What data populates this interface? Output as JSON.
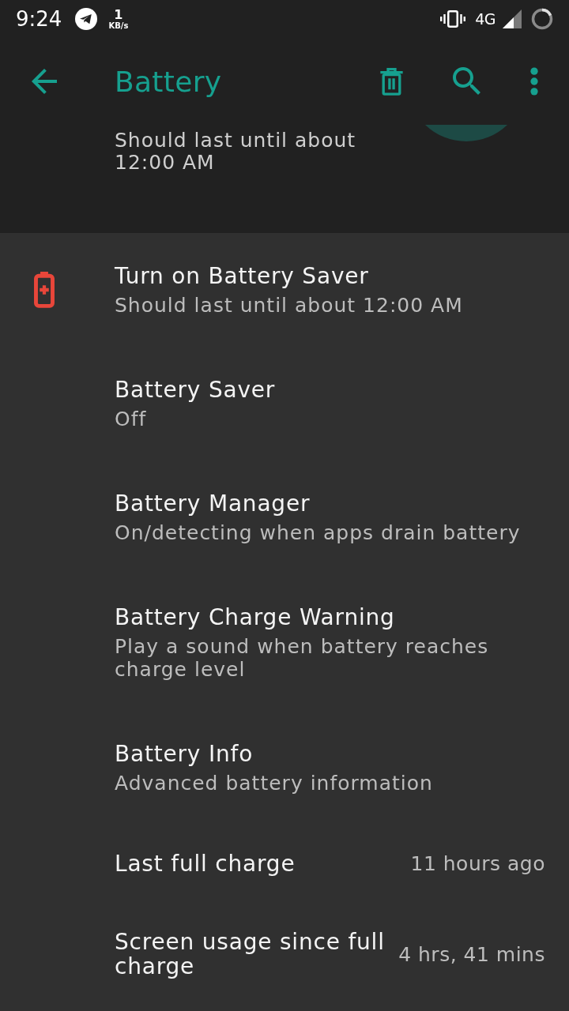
{
  "status_bar": {
    "time": "9:24",
    "net_speed": "1",
    "net_speed_unit": "KB/s",
    "network_type": "4G"
  },
  "toolbar": {
    "title": "Battery"
  },
  "estimate": {
    "text": "Should last until about 12:00 AM"
  },
  "settings": [
    {
      "kind": "warning",
      "title": "Turn on Battery Saver",
      "summary": "Should last until about 12:00 AM"
    },
    {
      "kind": "summary",
      "title": "Battery Saver",
      "summary": "Off"
    },
    {
      "kind": "summary",
      "title": "Battery Manager",
      "summary": "On/detecting when apps drain battery"
    },
    {
      "kind": "summary",
      "title": "Battery Charge Warning",
      "summary": "Play a sound when battery reaches charge level"
    },
    {
      "kind": "summary",
      "title": "Battery Info",
      "summary": "Advanced battery information"
    },
    {
      "kind": "value",
      "title": "Last full charge",
      "value": "11 hours ago"
    },
    {
      "kind": "value",
      "title": "Screen usage since full charge",
      "value": "4 hrs, 41 mins"
    }
  ]
}
